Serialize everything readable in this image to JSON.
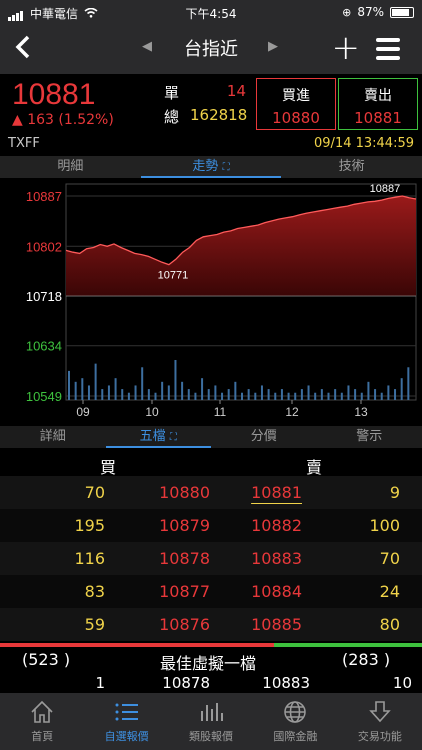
{
  "status": {
    "carrier": "中華電信",
    "time": "下午4:54",
    "battery": "87%"
  },
  "nav": {
    "title": "台指近",
    "back_label": "<",
    "prev_arrow": "◀",
    "next_arrow": "▶"
  },
  "quote": {
    "price": "10881",
    "change": "163 (1.52%)",
    "single_label": "單",
    "single_value": "14",
    "total_label": "總",
    "total_value": "162818",
    "buy_label": "買進",
    "buy_value": "10880",
    "sell_label": "賣出",
    "sell_value": "10881",
    "symbol": "TXFF",
    "timestamp": "09/14 13:44:59"
  },
  "chart_tabs": [
    {
      "label": "明細"
    },
    {
      "label": "走勢"
    },
    {
      "label": "技術"
    }
  ],
  "chart_data": {
    "type": "area",
    "y_ticks": [
      "10887",
      "10802",
      "10718",
      "10634",
      "10549"
    ],
    "x_ticks": [
      "09",
      "10",
      "11",
      "12",
      "13"
    ],
    "annotations": {
      "high": "10887",
      "low": "10771"
    },
    "ylim": [
      10549,
      10887
    ],
    "price_series": [
      10795,
      10792,
      10790,
      10798,
      10800,
      10805,
      10802,
      10806,
      10800,
      10795,
      10790,
      10788,
      10785,
      10780,
      10775,
      10771,
      10780,
      10792,
      10800,
      10812,
      10818,
      10820,
      10822,
      10826,
      10828,
      10832,
      10834,
      10836,
      10838,
      10842,
      10845,
      10848,
      10850,
      10852,
      10855,
      10858,
      10860,
      10862,
      10864,
      10866,
      10868,
      10870,
      10873,
      10875,
      10877,
      10878,
      10880,
      10883,
      10885,
      10887,
      10884,
      10882
    ],
    "reference_price": 10718,
    "volume_series": [
      8,
      5,
      6,
      4,
      10,
      3,
      4,
      6,
      3,
      2,
      4,
      9,
      3,
      2,
      5,
      4,
      11,
      5,
      3,
      2,
      6,
      3,
      4,
      2,
      3,
      5,
      2,
      3,
      2,
      4,
      3,
      2,
      3,
      2,
      2,
      3,
      4,
      2,
      3,
      2,
      3,
      2,
      4,
      3,
      2,
      5,
      3,
      2,
      4,
      3,
      6,
      9
    ]
  },
  "book_tabs": [
    {
      "label": "詳細"
    },
    {
      "label": "五檔"
    },
    {
      "label": "分價"
    },
    {
      "label": "警示"
    }
  ],
  "book": {
    "buy_header": "買",
    "sell_header": "賣",
    "rows": [
      {
        "buy_qty": "70",
        "bid": "10880",
        "ask": "10881",
        "sell_qty": "9"
      },
      {
        "buy_qty": "195",
        "bid": "10879",
        "ask": "10882",
        "sell_qty": "100"
      },
      {
        "buy_qty": "116",
        "bid": "10878",
        "ask": "10883",
        "sell_qty": "70"
      },
      {
        "buy_qty": "83",
        "bid": "10877",
        "ask": "10884",
        "sell_qty": "24"
      },
      {
        "buy_qty": "59",
        "bid": "10876",
        "ask": "10885",
        "sell_qty": "80"
      }
    ],
    "buy_total": "(523 )",
    "sell_total": "(283 )",
    "virtual_label": "最佳虛擬一檔",
    "virtual": {
      "buy_qty": "1",
      "bid": "10878",
      "ask": "10883",
      "sell_qty": "10"
    }
  },
  "tabbar": [
    {
      "label": "首頁",
      "icon": "home-icon"
    },
    {
      "label": "自選報價",
      "icon": "list-icon"
    },
    {
      "label": "類股報價",
      "icon": "bars-icon"
    },
    {
      "label": "國際金融",
      "icon": "globe-icon"
    },
    {
      "label": "交易功能",
      "icon": "trade-icon"
    }
  ],
  "colors": {
    "up": "#e8383a",
    "accent": "#3d8fe0",
    "qty": "#f0d34a",
    "green": "#3ec13e"
  }
}
